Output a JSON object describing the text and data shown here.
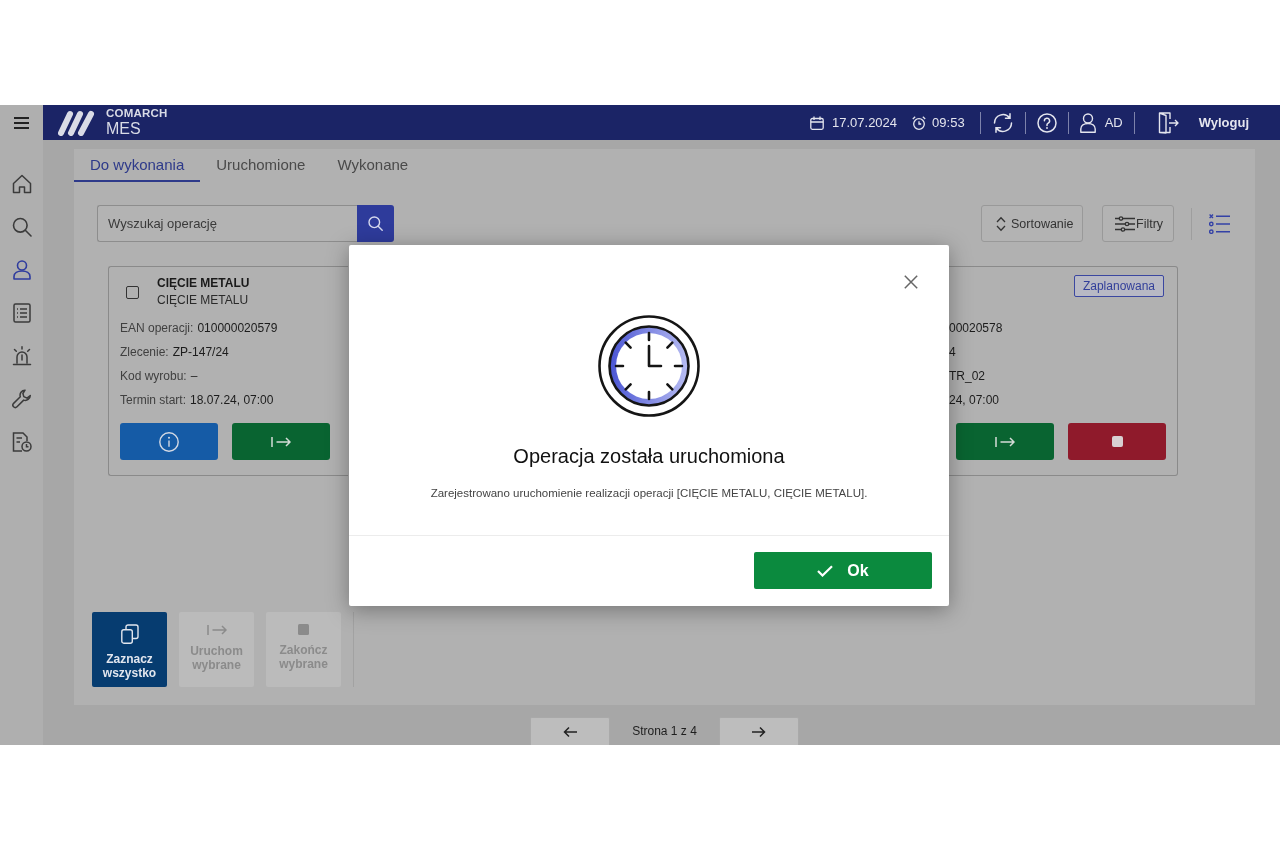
{
  "header": {
    "brand": "COMARCH",
    "product": "MES",
    "date": "17.07.2024",
    "time": "09:53",
    "user": "AD",
    "logout": "Wyloguj"
  },
  "sidebar": {
    "items": [
      {
        "selected": false
      },
      {
        "selected": false
      },
      {
        "selected": true
      },
      {
        "selected": false
      },
      {
        "selected": false
      },
      {
        "selected": false
      },
      {
        "selected": false
      }
    ]
  },
  "tabs": [
    {
      "label": "Do wykonania",
      "selected": true
    },
    {
      "label": "Uruchomione",
      "selected": false
    },
    {
      "label": "Wykonane",
      "selected": false
    }
  ],
  "search": {
    "placeholder": "Wyszukaj operację"
  },
  "toolbar": {
    "sort": "Sortowanie",
    "filter": "Filtry"
  },
  "cards": [
    {
      "title": "CIĘCIE METALU",
      "subtitle": "CIĘCIE METALU",
      "checked": false,
      "fields": [
        {
          "label": "EAN operacji:",
          "value": "010000020579"
        },
        {
          "label": "Zlecenie:",
          "value": "ZP-147/24"
        },
        {
          "label": "Kod wyrobu:",
          "placeholder": "–"
        },
        {
          "label": "Termin start:",
          "value": "18.07.24, 07:00"
        }
      ],
      "buttons": [
        {
          "kind": "info"
        },
        {
          "kind": "start"
        }
      ]
    },
    {
      "status": "Zaplanowana",
      "fields": [
        {
          "value": "00020578"
        },
        {
          "value": "4"
        },
        {
          "value": "TR_02"
        },
        {
          "value": "24, 07:00"
        }
      ],
      "buttons": [
        {
          "kind": "start"
        },
        {
          "kind": "stop"
        }
      ]
    }
  ],
  "bulk_actions": [
    {
      "kind": "select",
      "label": "Zaznacz wszystko",
      "disabled": false
    },
    {
      "kind": "start",
      "label": "Uruchom wybrane",
      "disabled": true
    },
    {
      "kind": "stop",
      "label": "Zakończ wybrane",
      "disabled": true
    }
  ],
  "pagination": {
    "label": "Strona 1 z 4"
  },
  "modal": {
    "title": "Operacja została uruchomiona",
    "message": "Zarejestrowano uruchomienie realizacji operacji [CIĘCIE METALU, CIĘCIE METALU].",
    "ok": "Ok"
  }
}
